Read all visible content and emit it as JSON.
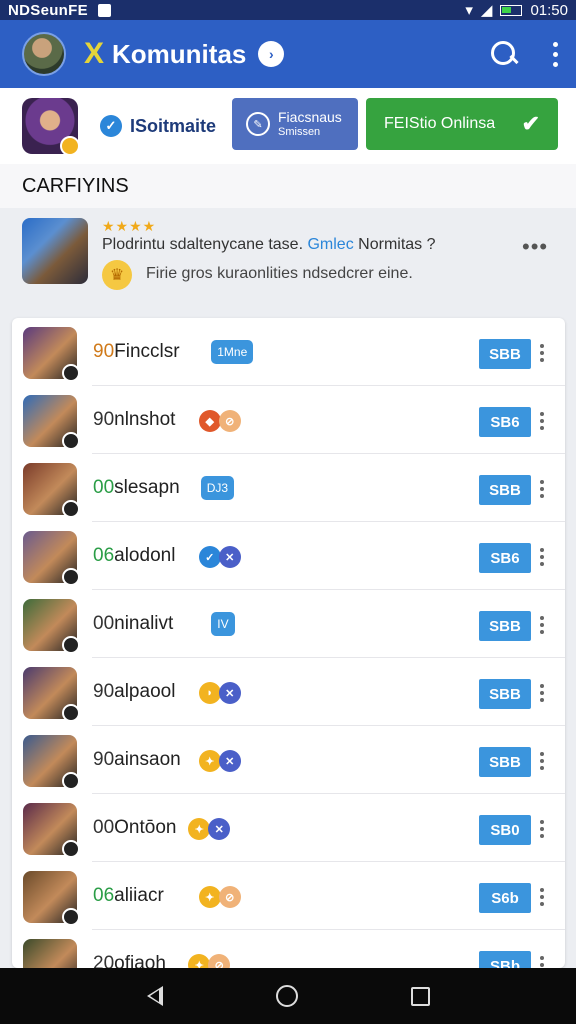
{
  "status_bar": {
    "carrier": "NDSeunFE",
    "time": "01:50"
  },
  "header": {
    "logo_glyph": "X",
    "title": "Komunitas",
    "title_badge": "›"
  },
  "profile": {
    "name": "ISoitmaite",
    "button_secondary": {
      "line1": "Fiacsnaus",
      "line2": "Smissen"
    },
    "button_primary": {
      "label": "FEIStio Onlinsa",
      "icon": "✔"
    }
  },
  "section": {
    "title": "CARFIYINS"
  },
  "post": {
    "stars": "★★★★",
    "text": "Plodrintu sdaltenycane tase.",
    "link": "Gmlec",
    "text_end": "Normitas ?",
    "subtext": "Firie gros kuraonlities ndsedcrer eine.",
    "more": "•••"
  },
  "list": {
    "items": [
      {
        "num": "90",
        "name": "Fincclsr",
        "tag": "1Mne",
        "action": "SBB",
        "num_color": "#d07a1a",
        "thumb": "#5a3a7e",
        "icons": []
      },
      {
        "num": "90",
        "name": "nlnshot",
        "action": "SB6",
        "num_color": "#333",
        "thumb": "#2f6bb8",
        "icons": [
          {
            "c": "#e0582a",
            "g": "◆"
          },
          {
            "c": "#f0b278",
            "g": "⊘"
          }
        ]
      },
      {
        "num": "00",
        "name": "slesapn",
        "tag": "DJ3",
        "action": "SBB",
        "num_color": "#2a9d46",
        "thumb": "#7a3b2a",
        "icons": []
      },
      {
        "num": "06",
        "name": "alodonl",
        "action": "SB6",
        "num_color": "#2a9d46",
        "thumb": "#6a5a8e",
        "icons": [
          {
            "c": "#2b86d9",
            "g": "✓"
          },
          {
            "c": "#4a5fc8",
            "g": "✕"
          }
        ]
      },
      {
        "num": "00",
        "name": "ninalivt",
        "tag": "IV",
        "action": "SBB",
        "num_color": "#333",
        "thumb": "#3d6b3a",
        "icons": []
      },
      {
        "num": "90",
        "name": "alpaool",
        "action": "SBB",
        "num_color": "#333",
        "thumb": "#4a3a6e",
        "icons": [
          {
            "c": "#f2b320",
            "g": "◗"
          },
          {
            "c": "#4a5fc8",
            "g": "✕"
          }
        ]
      },
      {
        "num": "90",
        "name": "ainsaon",
        "action": "SBB",
        "num_color": "#333",
        "thumb": "#3a5a8e",
        "icons": [
          {
            "c": "#f2b320",
            "g": "✦"
          },
          {
            "c": "#4a5fc8",
            "g": "✕"
          }
        ]
      },
      {
        "num": "00",
        "name": "Ontōon",
        "action": "SB0",
        "num_color": "#333",
        "thumb": "#5a2a4a",
        "icons": [
          {
            "c": "#f2b320",
            "g": "✦"
          },
          {
            "c": "#4a5fc8",
            "g": "✕"
          }
        ]
      },
      {
        "num": "06",
        "name": "aliiacr",
        "action": "S6b",
        "num_color": "#2a9d46",
        "thumb": "#6a4a2a",
        "icons": [
          {
            "c": "#f2b320",
            "g": "✦"
          },
          {
            "c": "#f0b278",
            "g": "⊘"
          }
        ]
      },
      {
        "num": "20",
        "name": "ofiaoh",
        "action": "SBb",
        "num_color": "#333",
        "thumb": "#3a4a2a",
        "icons": [
          {
            "c": "#f2b320",
            "g": "✦"
          },
          {
            "c": "#f0b278",
            "g": "⊘"
          }
        ]
      }
    ]
  }
}
